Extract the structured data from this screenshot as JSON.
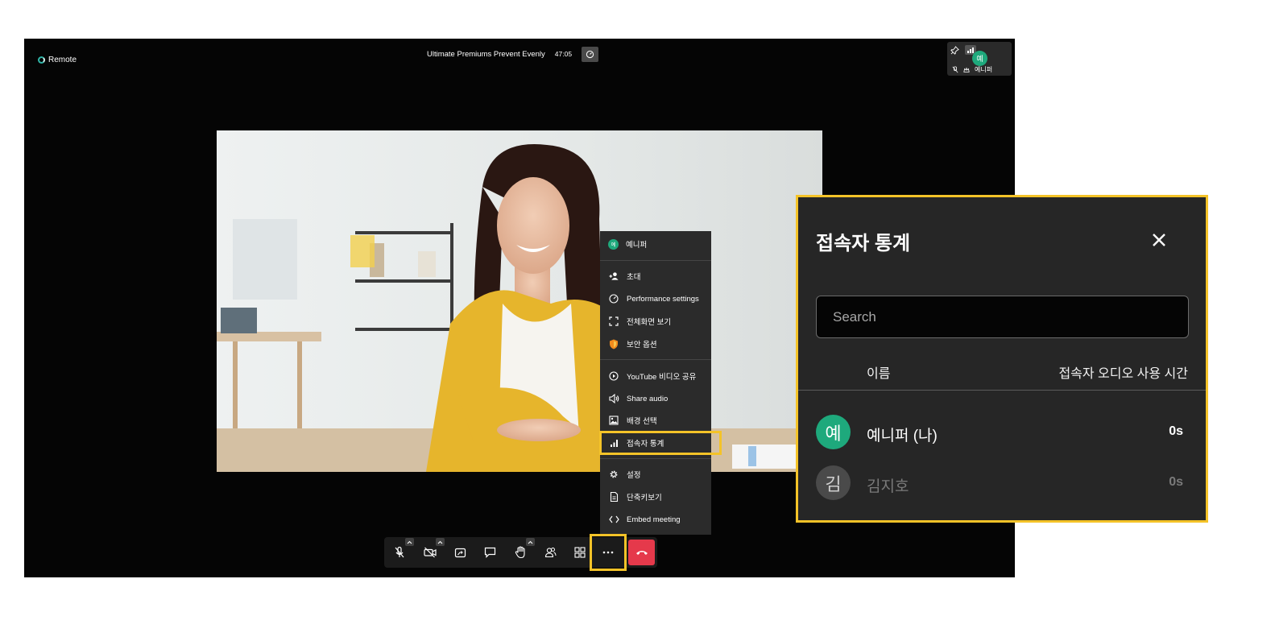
{
  "app": {
    "brand_name": "Remote"
  },
  "meeting": {
    "title": "Ultimate Premiums Prevent Evenly",
    "timer": "47:05"
  },
  "self_tile": {
    "avatar_initial": "예",
    "name": "예니퍼"
  },
  "menu": {
    "user": {
      "initial": "예",
      "name": "예니퍼"
    },
    "items": [
      {
        "label": "초대",
        "icon": "add-user-icon"
      },
      {
        "label": "Performance settings",
        "icon": "gauge-icon"
      },
      {
        "label": "전체화면 보기",
        "icon": "fullscreen-icon"
      },
      {
        "label": "보안 옵션",
        "icon": "shield-icon"
      },
      {
        "label": "YouTube 비디오 공유",
        "icon": "play-circle-icon"
      },
      {
        "label": "Share audio",
        "icon": "speaker-icon"
      },
      {
        "label": "배경 선택",
        "icon": "image-icon"
      },
      {
        "label": "접속자 통계",
        "icon": "bar-chart-icon",
        "highlighted": true
      },
      {
        "label": "설정",
        "icon": "gear-icon"
      },
      {
        "label": "단축키보기",
        "icon": "document-icon"
      },
      {
        "label": "Embed meeting",
        "icon": "code-icon"
      }
    ]
  },
  "toolbar": {
    "buttons": [
      "mic-muted-icon",
      "camera-off-icon",
      "screen-share-icon",
      "chat-icon",
      "raise-hand-icon",
      "participants-icon",
      "tile-view-icon",
      "more-icon",
      "hangup-icon"
    ]
  },
  "stats_panel": {
    "title": "접속자 통계",
    "search_placeholder": "Search",
    "col_name": "이름",
    "col_time": "접속자 오디오 사용 시간",
    "participants": [
      {
        "initial": "예",
        "name": "예니퍼 (나)",
        "time": "0s",
        "avatar_color": "#1ea97c",
        "active": true
      },
      {
        "initial": "김",
        "name": "김지호",
        "time": "0s",
        "avatar_color": "#4a4a4a",
        "active": false
      }
    ]
  },
  "colors": {
    "highlight": "#f4c328",
    "hangup": "#e5394b",
    "accent": "#1ea97c"
  }
}
